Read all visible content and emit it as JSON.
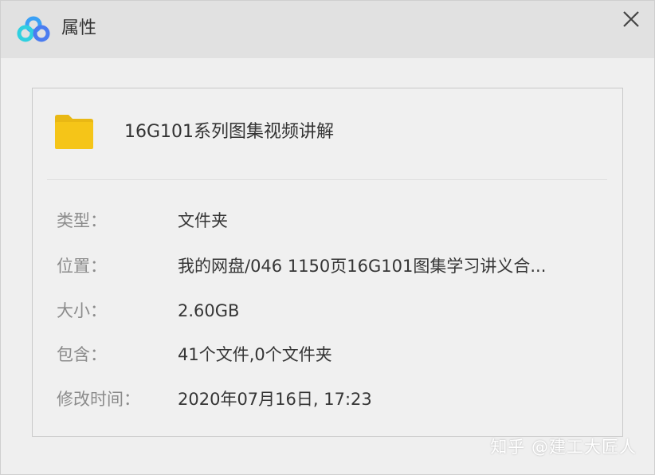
{
  "window": {
    "title": "属性",
    "app_icon": "baidu-netdisk-cloud-icon",
    "close_icon": "close-icon"
  },
  "file": {
    "icon": "folder-icon",
    "folder_color": "#f5c518",
    "name": "16G101系列图集视频讲解"
  },
  "properties": [
    {
      "label": "类型：",
      "value": "文件夹"
    },
    {
      "label": "位置：",
      "value": "我的网盘/046  1150页16G101图集学习讲义合..."
    },
    {
      "label": "大小：",
      "value": "2.60GB"
    },
    {
      "label": "包含：",
      "value": "41个文件,0个文件夹"
    },
    {
      "label": "修改时间：",
      "value": "2020年07月16日, 17:23"
    }
  ],
  "watermark": "知乎 @建工大匠人",
  "colors": {
    "title_bar": "#e1e1e1",
    "panel_bg": "#f0f0f0",
    "label_text": "#8b8b8b",
    "value_text": "#353535"
  }
}
